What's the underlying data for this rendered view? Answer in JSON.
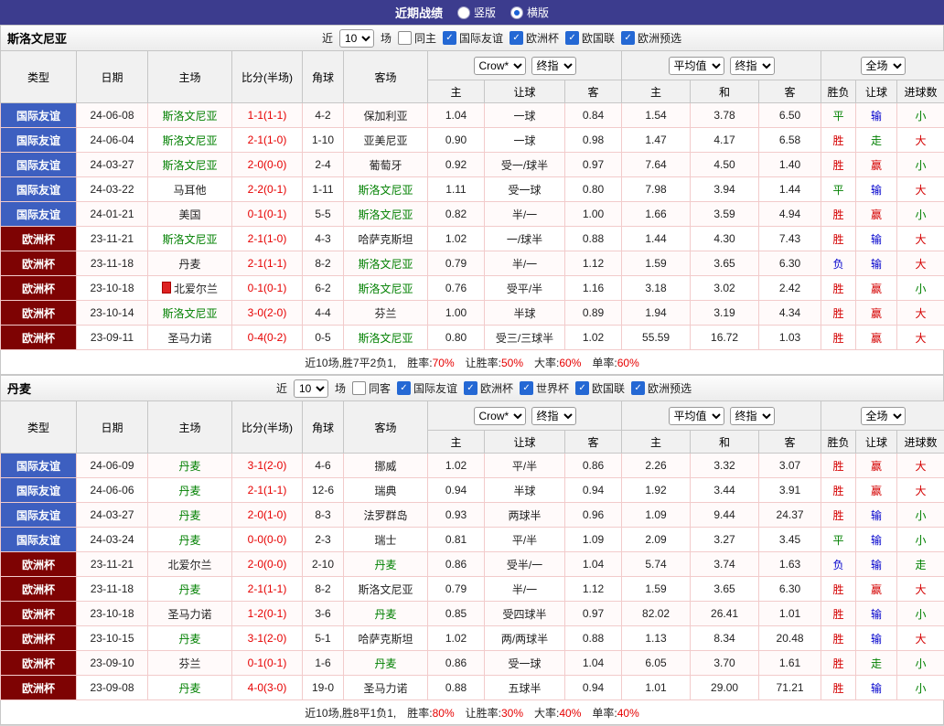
{
  "top_bar": {
    "title": "近期战绩",
    "radios": [
      {
        "label": "竖版",
        "selected": false
      },
      {
        "label": "横版",
        "selected": true
      }
    ]
  },
  "columns": {
    "type": "类型",
    "date": "日期",
    "home": "主场",
    "score": "比分(半场)",
    "corner": "角球",
    "away": "客场",
    "bookmaker": "Crow*",
    "asia_final": "终指",
    "asia_sub": [
      "主",
      "让球",
      "客"
    ],
    "average": "平均值",
    "euro_final": "终指",
    "euro_sub": [
      "主",
      "和",
      "客"
    ],
    "scope": "全场",
    "result_sub": [
      "胜负",
      "让球",
      "进球数"
    ]
  },
  "sections": [
    {
      "team": "斯洛文尼亚",
      "filter": {
        "near": "近",
        "count": "10",
        "games": "场",
        "same": {
          "label": "同主",
          "checked": false
        },
        "leagues": [
          {
            "label": "国际友谊",
            "checked": true
          },
          {
            "label": "欧洲杯",
            "checked": true
          },
          {
            "label": "欧国联",
            "checked": true
          },
          {
            "label": "欧洲预选",
            "checked": true
          }
        ]
      },
      "rows": [
        {
          "type": "国际友谊",
          "type_class": "friendly",
          "date": "24-06-08",
          "home": "斯洛文尼亚",
          "home_focus": true,
          "home_icon": false,
          "score": "1-1(1-1)",
          "corner": "4-2",
          "away": "保加利亚",
          "away_focus": false,
          "asia": [
            "1.04",
            "一球",
            "0.84"
          ],
          "europe": [
            "1.54",
            "3.78",
            "6.50"
          ],
          "results": [
            {
              "t": "平",
              "c": "green"
            },
            {
              "t": "输",
              "c": "blue"
            },
            {
              "t": "小",
              "c": "green"
            }
          ]
        },
        {
          "type": "国际友谊",
          "type_class": "friendly",
          "date": "24-06-04",
          "home": "斯洛文尼亚",
          "home_focus": true,
          "home_icon": false,
          "score": "2-1(1-0)",
          "corner": "1-10",
          "away": "亚美尼亚",
          "away_focus": false,
          "asia": [
            "0.90",
            "一球",
            "0.98"
          ],
          "europe": [
            "1.47",
            "4.17",
            "6.58"
          ],
          "results": [
            {
              "t": "胜",
              "c": "red"
            },
            {
              "t": "走",
              "c": "green"
            },
            {
              "t": "大",
              "c": "red"
            }
          ]
        },
        {
          "type": "国际友谊",
          "type_class": "friendly",
          "date": "24-03-27",
          "home": "斯洛文尼亚",
          "home_focus": true,
          "home_icon": false,
          "score": "2-0(0-0)",
          "corner": "2-4",
          "away": "葡萄牙",
          "away_focus": false,
          "asia": [
            "0.92",
            "受一/球半",
            "0.97"
          ],
          "europe": [
            "7.64",
            "4.50",
            "1.40"
          ],
          "results": [
            {
              "t": "胜",
              "c": "red"
            },
            {
              "t": "赢",
              "c": "red"
            },
            {
              "t": "小",
              "c": "green"
            }
          ]
        },
        {
          "type": "国际友谊",
          "type_class": "friendly",
          "date": "24-03-22",
          "home": "马耳他",
          "home_focus": false,
          "home_icon": false,
          "score": "2-2(0-1)",
          "corner": "1-11",
          "away": "斯洛文尼亚",
          "away_focus": true,
          "asia": [
            "1.11",
            "受一球",
            "0.80"
          ],
          "europe": [
            "7.98",
            "3.94",
            "1.44"
          ],
          "results": [
            {
              "t": "平",
              "c": "green"
            },
            {
              "t": "输",
              "c": "blue"
            },
            {
              "t": "大",
              "c": "red"
            }
          ]
        },
        {
          "type": "国际友谊",
          "type_class": "friendly",
          "date": "24-01-21",
          "home": "美国",
          "home_focus": false,
          "home_icon": false,
          "score": "0-1(0-1)",
          "corner": "5-5",
          "away": "斯洛文尼亚",
          "away_focus": true,
          "asia": [
            "0.82",
            "半/一",
            "1.00"
          ],
          "europe": [
            "1.66",
            "3.59",
            "4.94"
          ],
          "results": [
            {
              "t": "胜",
              "c": "red"
            },
            {
              "t": "赢",
              "c": "red"
            },
            {
              "t": "小",
              "c": "green"
            }
          ]
        },
        {
          "type": "欧洲杯",
          "type_class": "cup",
          "date": "23-11-21",
          "home": "斯洛文尼亚",
          "home_focus": true,
          "home_icon": false,
          "score": "2-1(1-0)",
          "corner": "4-3",
          "away": "哈萨克斯坦",
          "away_focus": false,
          "asia": [
            "1.02",
            "一/球半",
            "0.88"
          ],
          "europe": [
            "1.44",
            "4.30",
            "7.43"
          ],
          "results": [
            {
              "t": "胜",
              "c": "red"
            },
            {
              "t": "输",
              "c": "blue"
            },
            {
              "t": "大",
              "c": "red"
            }
          ]
        },
        {
          "type": "欧洲杯",
          "type_class": "cup",
          "date": "23-11-18",
          "home": "丹麦",
          "home_focus": false,
          "home_icon": false,
          "score": "2-1(1-1)",
          "corner": "8-2",
          "away": "斯洛文尼亚",
          "away_focus": true,
          "asia": [
            "0.79",
            "半/一",
            "1.12"
          ],
          "europe": [
            "1.59",
            "3.65",
            "6.30"
          ],
          "results": [
            {
              "t": "负",
              "c": "blue"
            },
            {
              "t": "输",
              "c": "blue"
            },
            {
              "t": "大",
              "c": "red"
            }
          ]
        },
        {
          "type": "欧洲杯",
          "type_class": "cup",
          "date": "23-10-18",
          "home": "北爱尔兰",
          "home_focus": false,
          "home_icon": true,
          "score": "0-1(0-1)",
          "corner": "6-2",
          "away": "斯洛文尼亚",
          "away_focus": true,
          "asia": [
            "0.76",
            "受平/半",
            "1.16"
          ],
          "europe": [
            "3.18",
            "3.02",
            "2.42"
          ],
          "results": [
            {
              "t": "胜",
              "c": "red"
            },
            {
              "t": "赢",
              "c": "red"
            },
            {
              "t": "小",
              "c": "green"
            }
          ]
        },
        {
          "type": "欧洲杯",
          "type_class": "cup",
          "date": "23-10-14",
          "home": "斯洛文尼亚",
          "home_focus": true,
          "home_icon": false,
          "score": "3-0(2-0)",
          "corner": "4-4",
          "away": "芬兰",
          "away_focus": false,
          "asia": [
            "1.00",
            "半球",
            "0.89"
          ],
          "europe": [
            "1.94",
            "3.19",
            "4.34"
          ],
          "results": [
            {
              "t": "胜",
              "c": "red"
            },
            {
              "t": "赢",
              "c": "red"
            },
            {
              "t": "大",
              "c": "red"
            }
          ]
        },
        {
          "type": "欧洲杯",
          "type_class": "cup",
          "date": "23-09-11",
          "home": "圣马力诺",
          "home_focus": false,
          "home_icon": false,
          "score": "0-4(0-2)",
          "corner": "0-5",
          "away": "斯洛文尼亚",
          "away_focus": true,
          "asia": [
            "0.80",
            "受三/三球半",
            "1.02"
          ],
          "europe": [
            "55.59",
            "16.72",
            "1.03"
          ],
          "results": [
            {
              "t": "胜",
              "c": "red"
            },
            {
              "t": "赢",
              "c": "red"
            },
            {
              "t": "大",
              "c": "red"
            }
          ]
        }
      ],
      "summary": {
        "record": "近10场,胜7平2负1,",
        "stats": [
          {
            "label": "胜率:",
            "value": "70%"
          },
          {
            "label": "让胜率:",
            "value": "50%"
          },
          {
            "label": "大率:",
            "value": "60%"
          },
          {
            "label": "单率:",
            "value": "60%"
          }
        ]
      }
    },
    {
      "team": "丹麦",
      "filter": {
        "near": "近",
        "count": "10",
        "games": "场",
        "same": {
          "label": "同客",
          "checked": false
        },
        "leagues": [
          {
            "label": "国际友谊",
            "checked": true
          },
          {
            "label": "欧洲杯",
            "checked": true
          },
          {
            "label": "世界杯",
            "checked": true
          },
          {
            "label": "欧国联",
            "checked": true
          },
          {
            "label": "欧洲预选",
            "checked": true
          }
        ]
      },
      "rows": [
        {
          "type": "国际友谊",
          "type_class": "friendly",
          "date": "24-06-09",
          "home": "丹麦",
          "home_focus": true,
          "home_icon": false,
          "score": "3-1(2-0)",
          "corner": "4-6",
          "away": "挪威",
          "away_focus": false,
          "asia": [
            "1.02",
            "平/半",
            "0.86"
          ],
          "europe": [
            "2.26",
            "3.32",
            "3.07"
          ],
          "results": [
            {
              "t": "胜",
              "c": "red"
            },
            {
              "t": "赢",
              "c": "red"
            },
            {
              "t": "大",
              "c": "red"
            }
          ]
        },
        {
          "type": "国际友谊",
          "type_class": "friendly",
          "date": "24-06-06",
          "home": "丹麦",
          "home_focus": true,
          "home_icon": false,
          "score": "2-1(1-1)",
          "corner": "12-6",
          "away": "瑞典",
          "away_focus": false,
          "asia": [
            "0.94",
            "半球",
            "0.94"
          ],
          "europe": [
            "1.92",
            "3.44",
            "3.91"
          ],
          "results": [
            {
              "t": "胜",
              "c": "red"
            },
            {
              "t": "赢",
              "c": "red"
            },
            {
              "t": "大",
              "c": "red"
            }
          ]
        },
        {
          "type": "国际友谊",
          "type_class": "friendly",
          "date": "24-03-27",
          "home": "丹麦",
          "home_focus": true,
          "home_icon": false,
          "score": "2-0(1-0)",
          "corner": "8-3",
          "away": "法罗群岛",
          "away_focus": false,
          "asia": [
            "0.93",
            "两球半",
            "0.96"
          ],
          "europe": [
            "1.09",
            "9.44",
            "24.37"
          ],
          "results": [
            {
              "t": "胜",
              "c": "red"
            },
            {
              "t": "输",
              "c": "blue"
            },
            {
              "t": "小",
              "c": "green"
            }
          ]
        },
        {
          "type": "国际友谊",
          "type_class": "friendly",
          "date": "24-03-24",
          "home": "丹麦",
          "home_focus": true,
          "home_icon": false,
          "score": "0-0(0-0)",
          "corner": "2-3",
          "away": "瑞士",
          "away_focus": false,
          "asia": [
            "0.81",
            "平/半",
            "1.09"
          ],
          "europe": [
            "2.09",
            "3.27",
            "3.45"
          ],
          "results": [
            {
              "t": "平",
              "c": "green"
            },
            {
              "t": "输",
              "c": "blue"
            },
            {
              "t": "小",
              "c": "green"
            }
          ]
        },
        {
          "type": "欧洲杯",
          "type_class": "cup",
          "date": "23-11-21",
          "home": "北爱尔兰",
          "home_focus": false,
          "home_icon": false,
          "score": "2-0(0-0)",
          "corner": "2-10",
          "away": "丹麦",
          "away_focus": true,
          "asia": [
            "0.86",
            "受半/一",
            "1.04"
          ],
          "europe": [
            "5.74",
            "3.74",
            "1.63"
          ],
          "results": [
            {
              "t": "负",
              "c": "blue"
            },
            {
              "t": "输",
              "c": "blue"
            },
            {
              "t": "走",
              "c": "green"
            }
          ]
        },
        {
          "type": "欧洲杯",
          "type_class": "cup",
          "date": "23-11-18",
          "home": "丹麦",
          "home_focus": true,
          "home_icon": false,
          "score": "2-1(1-1)",
          "corner": "8-2",
          "away": "斯洛文尼亚",
          "away_focus": false,
          "asia": [
            "0.79",
            "半/一",
            "1.12"
          ],
          "europe": [
            "1.59",
            "3.65",
            "6.30"
          ],
          "results": [
            {
              "t": "胜",
              "c": "red"
            },
            {
              "t": "赢",
              "c": "red"
            },
            {
              "t": "大",
              "c": "red"
            }
          ]
        },
        {
          "type": "欧洲杯",
          "type_class": "cup",
          "date": "23-10-18",
          "home": "圣马力诺",
          "home_focus": false,
          "home_icon": false,
          "score": "1-2(0-1)",
          "corner": "3-6",
          "away": "丹麦",
          "away_focus": true,
          "asia": [
            "0.85",
            "受四球半",
            "0.97"
          ],
          "europe": [
            "82.02",
            "26.41",
            "1.01"
          ],
          "results": [
            {
              "t": "胜",
              "c": "red"
            },
            {
              "t": "输",
              "c": "blue"
            },
            {
              "t": "小",
              "c": "green"
            }
          ]
        },
        {
          "type": "欧洲杯",
          "type_class": "cup",
          "date": "23-10-15",
          "home": "丹麦",
          "home_focus": true,
          "home_icon": false,
          "score": "3-1(2-0)",
          "corner": "5-1",
          "away": "哈萨克斯坦",
          "away_focus": false,
          "asia": [
            "1.02",
            "两/两球半",
            "0.88"
          ],
          "europe": [
            "1.13",
            "8.34",
            "20.48"
          ],
          "results": [
            {
              "t": "胜",
              "c": "red"
            },
            {
              "t": "输",
              "c": "blue"
            },
            {
              "t": "大",
              "c": "red"
            }
          ]
        },
        {
          "type": "欧洲杯",
          "type_class": "cup",
          "date": "23-09-10",
          "home": "芬兰",
          "home_focus": false,
          "home_icon": false,
          "score": "0-1(0-1)",
          "corner": "1-6",
          "away": "丹麦",
          "away_focus": true,
          "asia": [
            "0.86",
            "受一球",
            "1.04"
          ],
          "europe": [
            "6.05",
            "3.70",
            "1.61"
          ],
          "results": [
            {
              "t": "胜",
              "c": "red"
            },
            {
              "t": "走",
              "c": "green"
            },
            {
              "t": "小",
              "c": "green"
            }
          ]
        },
        {
          "type": "欧洲杯",
          "type_class": "cup",
          "date": "23-09-08",
          "home": "丹麦",
          "home_focus": true,
          "home_icon": false,
          "score": "4-0(3-0)",
          "corner": "19-0",
          "away": "圣马力诺",
          "away_focus": false,
          "asia": [
            "0.88",
            "五球半",
            "0.94"
          ],
          "europe": [
            "1.01",
            "29.00",
            "71.21"
          ],
          "results": [
            {
              "t": "胜",
              "c": "red"
            },
            {
              "t": "输",
              "c": "blue"
            },
            {
              "t": "小",
              "c": "green"
            }
          ]
        }
      ],
      "summary": {
        "record": "近10场,胜8平1负1,",
        "stats": [
          {
            "label": "胜率:",
            "value": "80%"
          },
          {
            "label": "让胜率:",
            "value": "30%"
          },
          {
            "label": "大率:",
            "value": "40%"
          },
          {
            "label": "单率:",
            "value": "40%"
          }
        ]
      }
    }
  ]
}
